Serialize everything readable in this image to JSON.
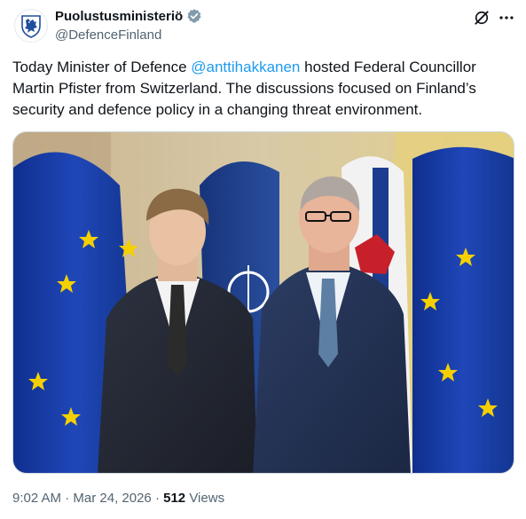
{
  "post": {
    "display_name": "Puolustusministeriö",
    "handle": "@DefenceFinland",
    "text_before": "Today Minister of Defence ",
    "mention": "@anttihakkanen",
    "text_after": " hosted Federal Councillor Martin Pfister from Switzerland. The discussions focused on Finland’s security and defence policy in a changing threat environment.",
    "time": "9:02 AM",
    "sep1": " · ",
    "date": "Mar 24, 2026",
    "sep2": " · ",
    "views_count": "512",
    "views_label": " Views"
  },
  "icons": {
    "avatar": "finnish-lion-shield-icon",
    "verified": "verified-badge-icon",
    "grok": "grok-icon",
    "more": "more-icon"
  },
  "colors": {
    "accent": "#1d9bf0",
    "verified_gray": "#829aab",
    "text": "#0f1419",
    "secondary": "#536471"
  }
}
